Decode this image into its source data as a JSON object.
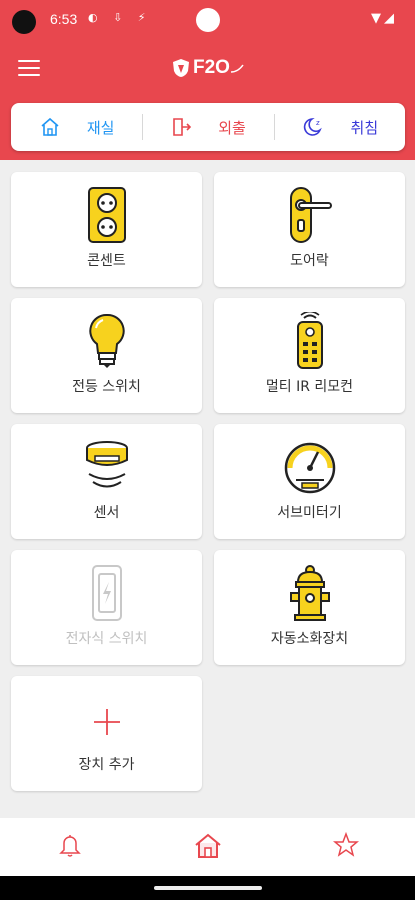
{
  "status_bar": {
    "time": "6:53"
  },
  "app": {
    "logo_text": "F2O"
  },
  "mode_bar": [
    {
      "label": "재실",
      "color": "#2196f3",
      "icon": "home-icon"
    },
    {
      "label": "외출",
      "color": "#e8474e",
      "icon": "exit-door-icon"
    },
    {
      "label": "취침",
      "color": "#3a3ad8",
      "icon": "moon-sleep-icon"
    }
  ],
  "devices": [
    {
      "label": "콘센트",
      "icon": "outlet-icon",
      "enabled": true
    },
    {
      "label": "도어락",
      "icon": "door-lock-icon",
      "enabled": true
    },
    {
      "label": "전등 스위치",
      "icon": "light-bulb-icon",
      "enabled": true
    },
    {
      "label": "멀티 IR 리모컨",
      "icon": "ir-remote-icon",
      "enabled": true
    },
    {
      "label": "센서",
      "icon": "sensor-icon",
      "enabled": true
    },
    {
      "label": "서브미터기",
      "icon": "submeter-gauge-icon",
      "enabled": true
    },
    {
      "label": "전자식 스위치",
      "icon": "electronic-switch-icon",
      "enabled": false
    },
    {
      "label": "자동소화장치",
      "icon": "fire-hydrant-icon",
      "enabled": true
    },
    {
      "label": "장치 추가",
      "icon": "plus-icon",
      "enabled": true
    }
  ],
  "bottom_nav": [
    {
      "icon": "bell-icon"
    },
    {
      "icon": "home-icon"
    },
    {
      "icon": "star-icon"
    }
  ],
  "colors": {
    "accent": "#e8474e",
    "device_yellow": "#f7d21e",
    "background": "#efefef"
  }
}
